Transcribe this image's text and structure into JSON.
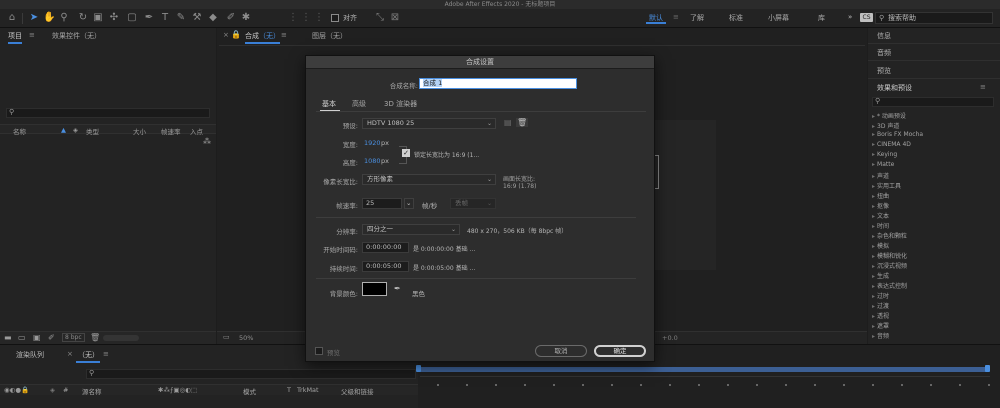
{
  "window": {
    "title": "Adobe After Effects 2020 - 无标题项目"
  },
  "toolbar": {
    "align_label": "对齐",
    "workspaces": [
      "默认",
      "了解",
      "标准",
      "小屏幕",
      "库"
    ],
    "more": "»",
    "search_placeholder": "搜索帮助"
  },
  "project_panel": {
    "tab_project": "项目",
    "tab_effects": "效果控件（无）",
    "menu": "≡",
    "columns": [
      "名称",
      "类型",
      "大小",
      "帧速率",
      "入点"
    ],
    "bpc": "8 bpc"
  },
  "composition_panel": {
    "tab_comp": "合成",
    "tab_comp_value": "（无）",
    "tab_layer": "图层（无）",
    "zoom": "50%",
    "time": "+0.0"
  },
  "right_panel": {
    "items": [
      "信息",
      "音频",
      "预览",
      "效果和预设"
    ],
    "list": [
      "* 动画预设",
      "3D 声道",
      "Boris FX Mocha",
      "CINEMA 4D",
      "Keying",
      "Matte",
      "声道",
      "实用工具",
      "扭曲",
      "抠像",
      "文本",
      "时间",
      "杂色和颗粒",
      "模拟",
      "模糊和锐化",
      "沉浸式视频",
      "生成",
      "表达式控制",
      "过时",
      "过渡",
      "透视",
      "遮罩",
      "音频"
    ]
  },
  "dialog": {
    "title": "合成设置",
    "name_label": "合成名称:",
    "name_value": "合成 1",
    "tabs": [
      "基本",
      "高级",
      "3D 渲染器"
    ],
    "preset_label": "预设:",
    "preset_value": "HDTV 1080 25",
    "width_label": "宽度:",
    "width_value": "1920",
    "height_label": "高度:",
    "height_value": "1080",
    "px": "px",
    "lock_label": "锁定长宽比为 16:9 (1...",
    "pixel_aspect_label": "像素长宽比:",
    "pixel_aspect_value": "方形像素",
    "frame_aspect_label": "画面长宽比:",
    "frame_aspect_value": "16:9 (1.78)",
    "fps_label": "帧速率:",
    "fps_value": "25",
    "fps_unit": "帧/秒",
    "drop_frame": "丢帧",
    "resolution_label": "分辨率:",
    "resolution_value": "四分之一",
    "resolution_info": "480 x 270，506 KB（每 8bpc 帧）",
    "start_label": "开始时间码:",
    "start_value": "0:00:00:00",
    "start_info": "是 0:00:00:00 基础 ...",
    "duration_label": "持续时间:",
    "duration_value": "0:00:05:00",
    "duration_info": "是 0:00:05:00 基础 ...",
    "bg_label": "背景颜色:",
    "bg_color_name": "黑色",
    "preview": "预览",
    "cancel": "取消",
    "ok": "确定",
    "colors": {
      "bg_swatch": "#000000",
      "ok_border": "#d0d0d0"
    }
  },
  "bottom_panel": {
    "render_queue": "渲染队列",
    "comp_tab": "（无）",
    "source_name": "源名称",
    "mode": "模式",
    "t": "T",
    "trkmat": "TrkMat",
    "parent": "父级和链接"
  }
}
